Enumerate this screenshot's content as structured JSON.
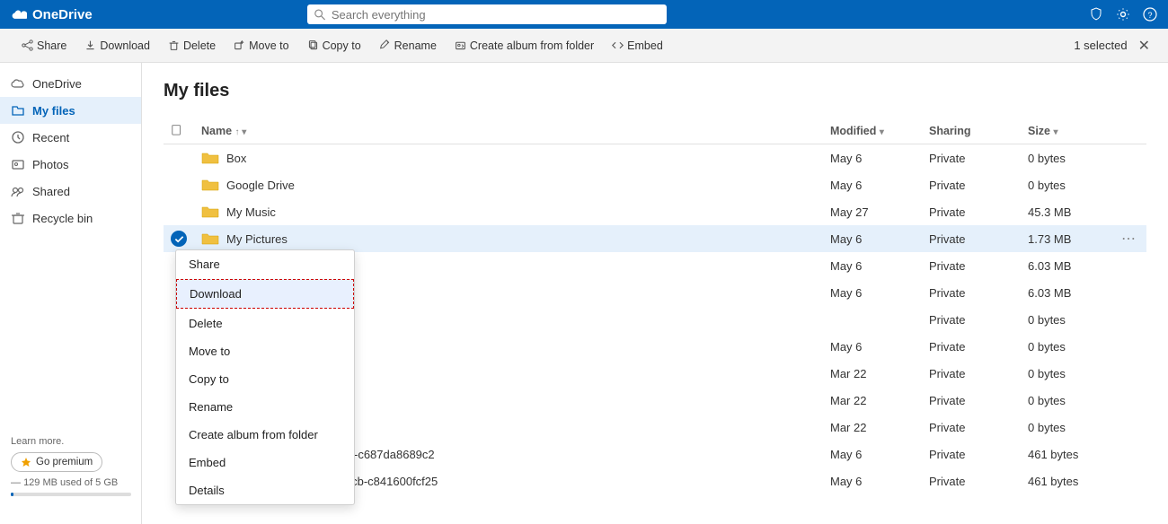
{
  "app": {
    "name": "OneDrive",
    "logo_label": "OneDrive"
  },
  "search": {
    "placeholder": "Search everything"
  },
  "actionbar": {
    "share": "Share",
    "download": "Download",
    "delete": "Delete",
    "move_to": "Move to",
    "copy_to": "Copy to",
    "rename": "Rename",
    "create_album": "Create album from folder",
    "embed": "Embed",
    "selected": "1 selected"
  },
  "sidebar": {
    "items": [
      {
        "id": "onedrive",
        "label": "OneDrive"
      },
      {
        "id": "my-files",
        "label": "My files"
      },
      {
        "id": "recent",
        "label": "Recent"
      },
      {
        "id": "photos",
        "label": "Photos"
      },
      {
        "id": "shared",
        "label": "Shared"
      },
      {
        "id": "recycle-bin",
        "label": "Recycle bin"
      }
    ],
    "storage_label": "129 MB used of 5 GB",
    "premium_btn": "Go premium"
  },
  "main": {
    "page_title": "My files",
    "table_headers": {
      "name": "Name",
      "modified": "Modified",
      "sharing": "Sharing",
      "size": "Size"
    },
    "rows": [
      {
        "type": "folder",
        "name": "Box",
        "modified": "May 6",
        "sharing": "Private",
        "size": "0 bytes",
        "selected": false
      },
      {
        "type": "folder",
        "name": "Google Drive",
        "modified": "May 6",
        "sharing": "Private",
        "size": "0 bytes",
        "selected": false
      },
      {
        "type": "folder",
        "name": "My Music",
        "modified": "May 27",
        "sharing": "Private",
        "size": "45.3 MB",
        "selected": false
      },
      {
        "type": "folder",
        "name": "My Pictures",
        "modified": "May 6",
        "sharing": "Private",
        "size": "1.73 MB",
        "selected": true
      },
      {
        "type": "folder",
        "name": "",
        "modified": "May 6",
        "sharing": "Private",
        "size": "6.03 MB",
        "selected": false
      },
      {
        "type": "folder",
        "name": "",
        "modified": "May 6",
        "sharing": "Private",
        "size": "6.03 MB",
        "selected": false
      },
      {
        "type": "folder",
        "name": "",
        "modified": "",
        "sharing": "Private",
        "size": "0 bytes",
        "selected": false
      },
      {
        "type": "folder",
        "name": "",
        "modified": "May 6",
        "sharing": "Private",
        "size": "0 bytes",
        "selected": false
      },
      {
        "type": "folder",
        "name": "",
        "modified": "Mar 22",
        "sharing": "Private",
        "size": "0 bytes",
        "selected": false
      },
      {
        "type": "folder",
        "name": "",
        "modified": "Mar 22",
        "sharing": "Private",
        "size": "0 bytes",
        "selected": false
      },
      {
        "type": "folder",
        "name": "",
        "modified": "Mar 22",
        "sharing": "Private",
        "size": "0 bytes",
        "selected": false
      },
      {
        "type": "file",
        "name": "1f8e6f42-8c58-4b27-a8fe-c687da8689c2",
        "modified": "May 6",
        "sharing": "Private",
        "size": "461 bytes",
        "selected": false
      },
      {
        "type": "file",
        "name": "912ea304-da13-4388-b1cb-c841600fcf25",
        "modified": "May 6",
        "sharing": "Private",
        "size": "461 bytes",
        "selected": false
      }
    ]
  },
  "context_menu": {
    "items": [
      {
        "id": "share",
        "label": "Share"
      },
      {
        "id": "download",
        "label": "Download"
      },
      {
        "id": "delete",
        "label": "Delete"
      },
      {
        "id": "move-to",
        "label": "Move to"
      },
      {
        "id": "copy-to",
        "label": "Copy to"
      },
      {
        "id": "rename",
        "label": "Rename"
      },
      {
        "id": "create-album",
        "label": "Create album from folder"
      },
      {
        "id": "embed",
        "label": "Embed"
      },
      {
        "id": "details",
        "label": "Details"
      }
    ]
  }
}
